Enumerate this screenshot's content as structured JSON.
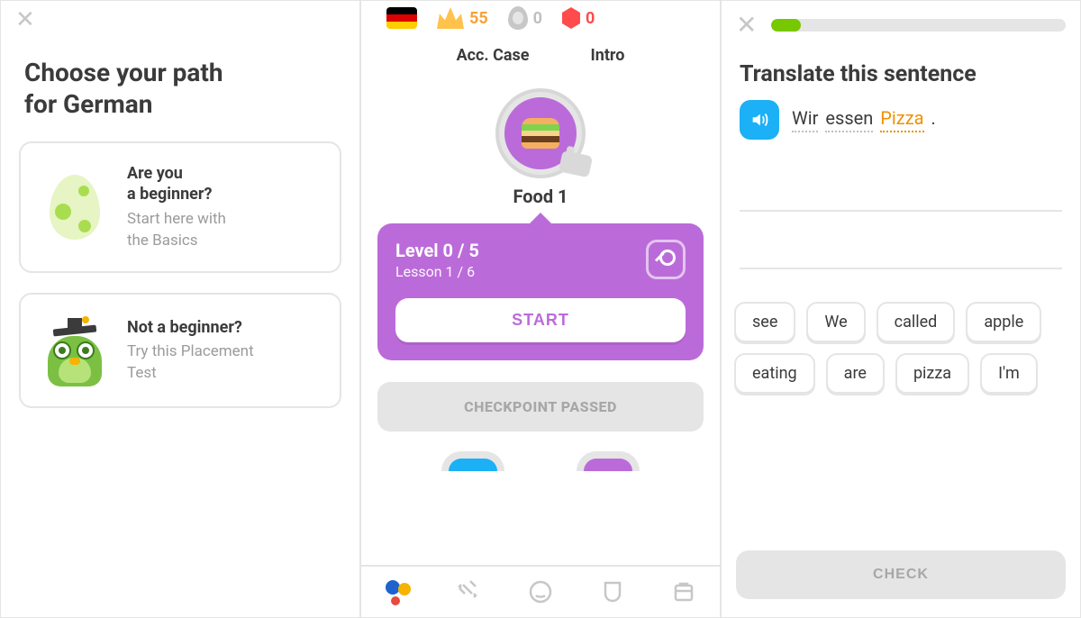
{
  "panel1": {
    "title_line1": "Choose your path",
    "title_line2": "for German",
    "beginner": {
      "title_line1": "Are you",
      "title_line2": "a beginner?",
      "sub_line1": "Start here with",
      "sub_line2": "the Basics"
    },
    "advanced": {
      "title": "Not a beginner?",
      "sub_line1": "Try this Placement",
      "sub_line2": "Test"
    }
  },
  "panel2": {
    "stats": {
      "crowns": "55",
      "streak": "0",
      "gems": "0"
    },
    "tabs": {
      "left": "Acc. Case",
      "right": "Intro"
    },
    "skill": {
      "name": "Food 1"
    },
    "tooltip": {
      "level_label": "Level 0 / 5",
      "lesson_label": "Lesson 1 / 6",
      "start_label": "START"
    },
    "checkpoint_label": "CHECKPOINT PASSED"
  },
  "panel3": {
    "progress_percent": 10,
    "title": "Translate this sentence",
    "sentence": {
      "w1": "Wir",
      "w2": "essen",
      "w3": "Pizza",
      "period": "."
    },
    "bank": {
      "w0": "see",
      "w1": "We",
      "w2": "called",
      "w3": "apple",
      "w4": "eating",
      "w5": "are",
      "w6": "pizza",
      "w7": "I'm"
    },
    "check_label": "CHECK"
  },
  "colors": {
    "accent_purple": "#bb6bd9",
    "accent_green": "#78c800",
    "accent_blue": "#1cb0f6",
    "accent_orange": "#f09000"
  }
}
